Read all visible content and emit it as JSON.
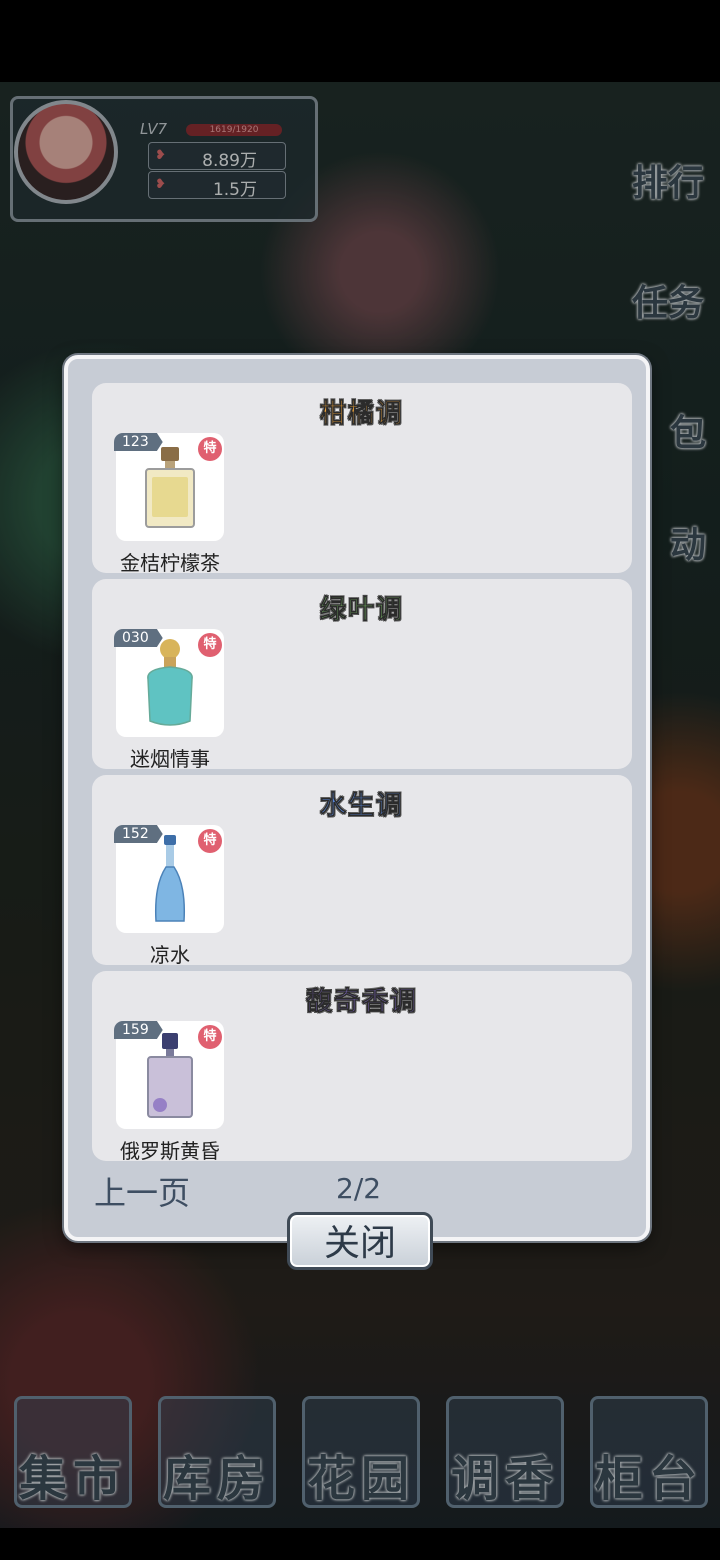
{
  "profile": {
    "level": "LV7",
    "exp_text": "1619/1920",
    "stat1": "8.89万",
    "stat2": "1.5万"
  },
  "side_menu": [
    "排行",
    "任务",
    "包",
    "动"
  ],
  "modal": {
    "categories": [
      {
        "title": "柑橘调",
        "title_color": "#f0a53c",
        "item": {
          "number": "123",
          "badge": "特",
          "name": "金桔柠檬茶",
          "bottle_color": "#e3d27a"
        }
      },
      {
        "title": "绿叶调",
        "title_color": "#7fc66b",
        "item": {
          "number": "030",
          "badge": "特",
          "name": "迷烟情事",
          "bottle_color": "#5fc3c2"
        }
      },
      {
        "title": "水生调",
        "title_color": "#5a86d6",
        "item": {
          "number": "152",
          "badge": "特",
          "name": "凉水",
          "bottle_color": "#7fb6e3"
        }
      },
      {
        "title": "馥奇香调",
        "title_color": "#8a6fd6",
        "item": {
          "number": "159",
          "badge": "特",
          "name": "俄罗斯黄昏",
          "bottle_color": "#c9c0d9"
        }
      }
    ],
    "prev_page": "上一页",
    "page_indicator": "2/2",
    "close_label": "关闭"
  },
  "bottom_nav": [
    "集市",
    "库房",
    "花园",
    "调香",
    "柜台"
  ]
}
